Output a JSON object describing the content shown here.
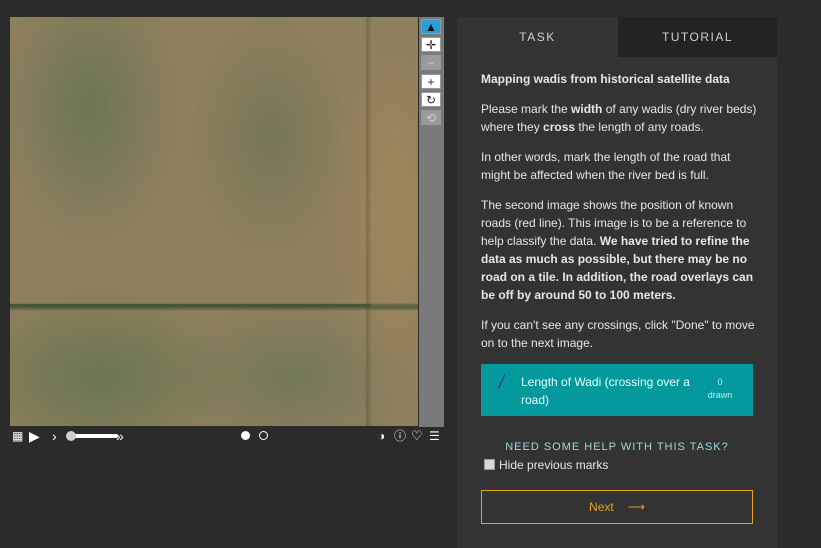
{
  "viewer": {
    "tools": {
      "pointer": "▲",
      "move": "✛",
      "zoom_out": "−",
      "zoom_in": "+",
      "rotate": "↻",
      "reset": "⟲"
    },
    "bottom_bar": {
      "grid_icon": "▦",
      "play_icon": "▶",
      "slow_icon": "›",
      "fast_icon": "»",
      "invert_icon": "◑",
      "info_icon": "ⓘ",
      "favorite_icon": "♡",
      "menu_icon": "☰"
    }
  },
  "panel": {
    "tabs": [
      "TASK",
      "TUTORIAL"
    ],
    "title": "Mapping wadis from historical satellite data",
    "p1_pre": "Please mark the ",
    "p1_b1": "width",
    "p1_mid": " of any wadis (dry river beds) where they ",
    "p1_b2": "cross",
    "p1_post": " the length of any roads.",
    "p2": "In other words, mark the length of the road that might be affected when the river bed is full.",
    "p3_pre": "The second image shows the position of known roads (red line). This image is to be a reference to help classify the data. ",
    "p3_bold": "We have tried to refine the data as much as possible, but there may be no road on a tile. In addition, the road overlays can be off by around 50 to 100 meters.",
    "p4": "If you can't see any crossings, click \"Done\" to move on to the next image.",
    "tool_label": "Length of Wadi (crossing over a road)",
    "tool_count_num": "0",
    "tool_count_word": "drawn",
    "help": "NEED SOME HELP WITH THIS TASK?",
    "hide_previous": "Hide previous marks",
    "next": "Next",
    "next_arrow": "⟶"
  },
  "colors": {
    "accent_teal": "#04999c",
    "next_orange": "#e6a21d",
    "active_tool_blue": "#2a9fd6"
  }
}
